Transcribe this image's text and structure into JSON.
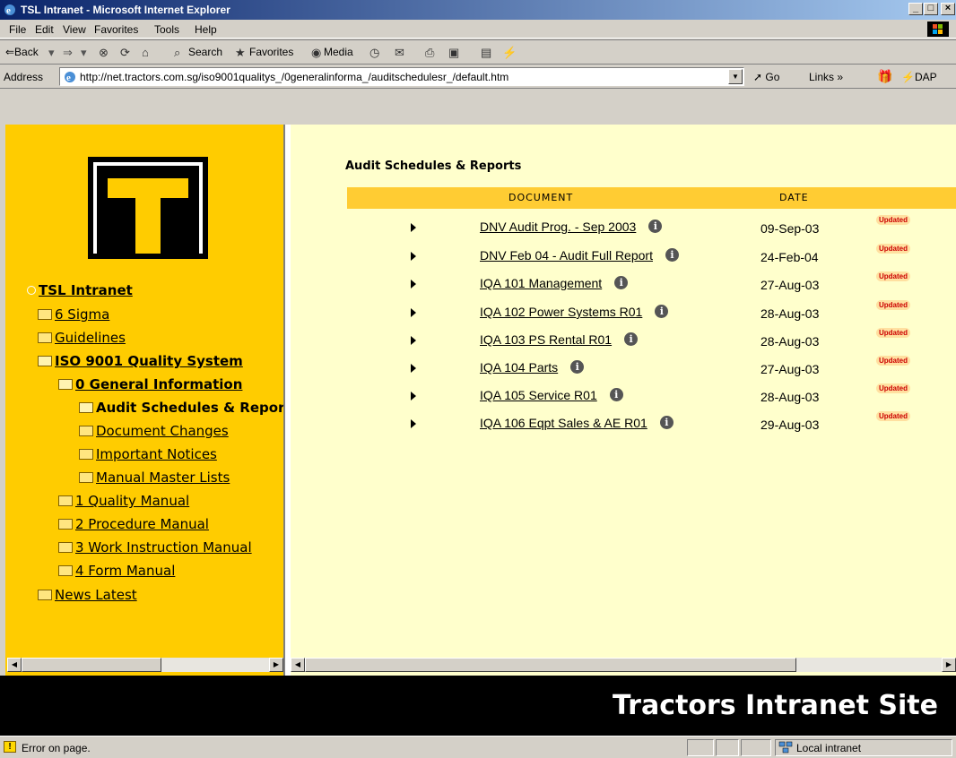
{
  "window": {
    "title": "TSL Intranet - Microsoft Internet Explorer",
    "minimize": "_",
    "maximize": "□",
    "close": "×"
  },
  "menu": [
    "File",
    "Edit",
    "View",
    "Favorites",
    "Tools",
    "Help"
  ],
  "toolbar": {
    "back": "⇐Back",
    "forward": "⇒",
    "search": "Search",
    "favorites": "Favorites",
    "media": "Media"
  },
  "address": {
    "label": "Address",
    "url": "http://net.tractors.com.sg/iso9001qualitys_/0generalinforma_/auditschedulesr_/default.htm",
    "go": "Go",
    "links": "Links »",
    "dap": "DAP"
  },
  "tree": [
    {
      "label": "TSL Intranet",
      "level": 0,
      "bold": true
    },
    {
      "label": "6 Sigma",
      "level": 1
    },
    {
      "label": "Guidelines",
      "level": 1
    },
    {
      "label": "ISO 9001 Quality System",
      "level": 1,
      "bold": true,
      "open": true
    },
    {
      "label": "0 General Information",
      "level": 2,
      "bold": true,
      "open": true
    },
    {
      "label": "Audit Schedules & Reports",
      "level": 3,
      "bold": true,
      "current": true
    },
    {
      "label": "Document Changes",
      "level": 3
    },
    {
      "label": "Important Notices",
      "level": 3
    },
    {
      "label": "Manual Master Lists",
      "level": 3
    },
    {
      "label": "1 Quality Manual",
      "level": 2
    },
    {
      "label": "2 Procedure Manual",
      "level": 2
    },
    {
      "label": "3 Work Instruction Manual",
      "level": 2
    },
    {
      "label": "4 Form Manual",
      "level": 2
    },
    {
      "label": "News Latest",
      "level": 1
    }
  ],
  "content": {
    "heading": "Audit Schedules & Reports",
    "col_document": "DOCUMENT",
    "col_date": "DATE",
    "rows": [
      {
        "document": "DNV Audit Prog. - Sep 2003",
        "date": "09-Sep-03",
        "badge": "Updated"
      },
      {
        "document": "DNV Feb 04 - Audit Full Report",
        "date": "24-Feb-04",
        "badge": "Updated"
      },
      {
        "document": "IQA 101 Management",
        "date": "27-Aug-03",
        "badge": "Updated"
      },
      {
        "document": "IQA 102 Power Systems R01",
        "date": "28-Aug-03",
        "badge": "Updated"
      },
      {
        "document": "IQA 103 PS Rental R01",
        "date": "28-Aug-03",
        "badge": "Updated"
      },
      {
        "document": "IQA 104 Parts",
        "date": "27-Aug-03",
        "badge": "Updated"
      },
      {
        "document": "IQA 105 Service R01",
        "date": "28-Aug-03",
        "badge": "Updated"
      },
      {
        "document": "IQA 106 Eqpt Sales & AE R01",
        "date": "29-Aug-03",
        "badge": "Updated"
      }
    ],
    "info_glyph": "i"
  },
  "banner": "Tractors Intranet Site",
  "status": {
    "text": "Error on page.",
    "zone": "Local intranet"
  },
  "colors": {
    "left_bg": "#ffcc00",
    "right_bg": "#ffffcc",
    "header_bg": "#ffcc33",
    "badge": "#cc0000"
  }
}
